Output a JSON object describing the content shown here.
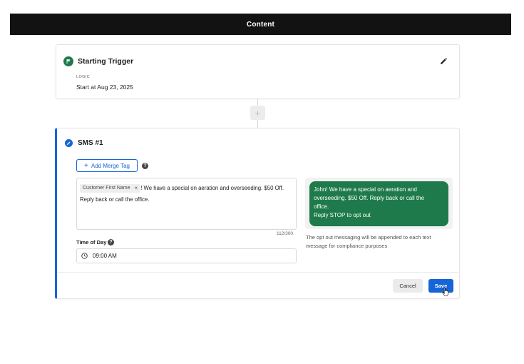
{
  "header": {
    "title": "Content"
  },
  "trigger": {
    "title": "Starting Trigger",
    "logic_label": "LOGIC",
    "logic_value": "Start at Aug 23, 2025",
    "icon": "flag-icon",
    "edit_icon": "pencil-icon"
  },
  "connector": {
    "add_symbol": "+"
  },
  "sms": {
    "title": "SMS #1",
    "add_merge_tag_label": "Add Merge Tag",
    "merge_chip": "Customer First Name",
    "merge_chip_remove": "×",
    "message_text": "! We have a special on aeration and overseeding. $50 Off. Reply back or call the office.",
    "char_count": "112/300",
    "time_of_day_label": "Time of Day",
    "time_value": "09:00 AM",
    "preview_lines": [
      "John! We have a special on aeration and",
      "overseeding. $50 Off. Reply back or call the",
      "office.",
      "Reply STOP to opt out"
    ],
    "optout_note": "The opt out messaging will be appended to each text message for compliance purposes",
    "cancel_label": "Cancel",
    "save_label": "Save"
  },
  "colors": {
    "accent": "#1565d8",
    "bubble": "#1e7a4b",
    "header_bg": "#121212"
  }
}
